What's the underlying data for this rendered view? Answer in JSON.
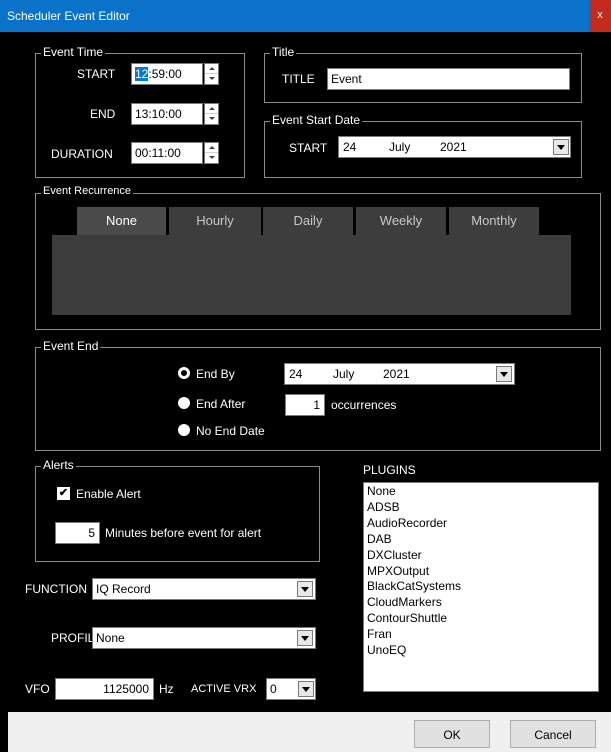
{
  "window": {
    "title": "Scheduler Event Editor",
    "close_glyph": "x"
  },
  "event_time": {
    "legend": "Event Time",
    "start_label": "START",
    "start_hh": "12",
    "start_rest": ":59:00",
    "end_label": "END",
    "end_value": "13:10:00",
    "duration_label": "DURATION",
    "duration_value": "00:11:00"
  },
  "title_group": {
    "legend": "Title",
    "label": "TITLE",
    "value": "Event"
  },
  "start_date": {
    "legend": "Event Start Date",
    "label": "START",
    "day": "24",
    "month": "July",
    "year": "2021"
  },
  "recurrence": {
    "legend": "Event Recurrence",
    "tabs": [
      {
        "label": "None",
        "active": true
      },
      {
        "label": "Hourly"
      },
      {
        "label": "Daily"
      },
      {
        "label": "Weekly"
      },
      {
        "label": "Monthly"
      }
    ]
  },
  "event_end": {
    "legend": "Event End",
    "end_by_label": "End By",
    "end_by_day": "24",
    "end_by_month": "July",
    "end_by_year": "2021",
    "end_after_label": "End After",
    "occurrences_value": "1",
    "occurrences_label": "occurrences",
    "no_end_label": "No End Date",
    "selected": "End By"
  },
  "alerts": {
    "legend": "Alerts",
    "enable_label": "Enable Alert",
    "enabled": true,
    "minutes_value": "5",
    "minutes_label": "Minutes before event for alert"
  },
  "function": {
    "label": "FUNCTION",
    "value": "IQ Record"
  },
  "profile": {
    "label": "PROFILE",
    "value": "None"
  },
  "vfo": {
    "label": "VFO",
    "value": "1125000",
    "unit": "Hz",
    "active_vrx_label": "ACTIVE VRX",
    "active_vrx_value": "0"
  },
  "plugins": {
    "label": "PLUGINS",
    "items": [
      "None",
      "ADSB",
      "AudioRecorder",
      "DAB",
      "DXCluster",
      "MPXOutput",
      "BlackCatSystems",
      "CloudMarkers",
      "ContourShuttle",
      "Fran",
      "UnoEQ"
    ]
  },
  "footer": {
    "ok_label": "OK",
    "cancel_label": "Cancel"
  }
}
